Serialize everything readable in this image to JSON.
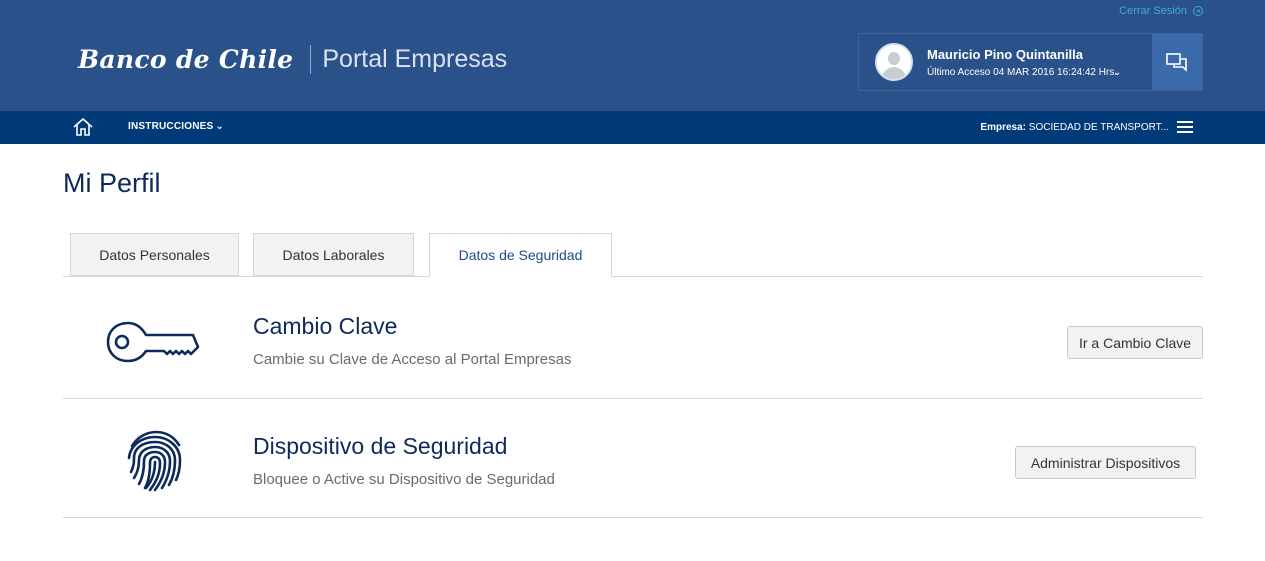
{
  "header": {
    "logout_label": "Cerrar Sesión",
    "brand_bank": "Banco de Chile",
    "brand_portal": "Portal Empresas",
    "user_name": "Mauricio Pino Quintanilla",
    "last_access": "Último Acceso 04 MAR 2016 16:24:42 Hrs."
  },
  "nav": {
    "menu_label": "INSTRUCCIONES",
    "company_label": "Empresa:",
    "company_value": "SOCIEDAD DE TRANSPORT..."
  },
  "page": {
    "title": "Mi Perfil"
  },
  "tabs": [
    {
      "label": "Datos Personales",
      "active": false
    },
    {
      "label": "Datos Laborales",
      "active": false
    },
    {
      "label": "Datos de Seguridad",
      "active": true
    }
  ],
  "security_items": [
    {
      "title": "Cambio Clave",
      "description": "Cambie su Clave de Acceso al Portal Empresas",
      "button": "Ir a Cambio Clave",
      "icon": "key-icon"
    },
    {
      "title": "Dispositivo de Seguridad",
      "description": "Bloquee o Active su Dispositivo de Seguridad",
      "button": "Administrar Dispositivos",
      "icon": "fingerprint-icon"
    }
  ],
  "colors": {
    "header_bg": "#2a5189",
    "nav_bg": "#003a78",
    "title_color": "#0d2a5a",
    "accent_link": "#41a9e1"
  }
}
